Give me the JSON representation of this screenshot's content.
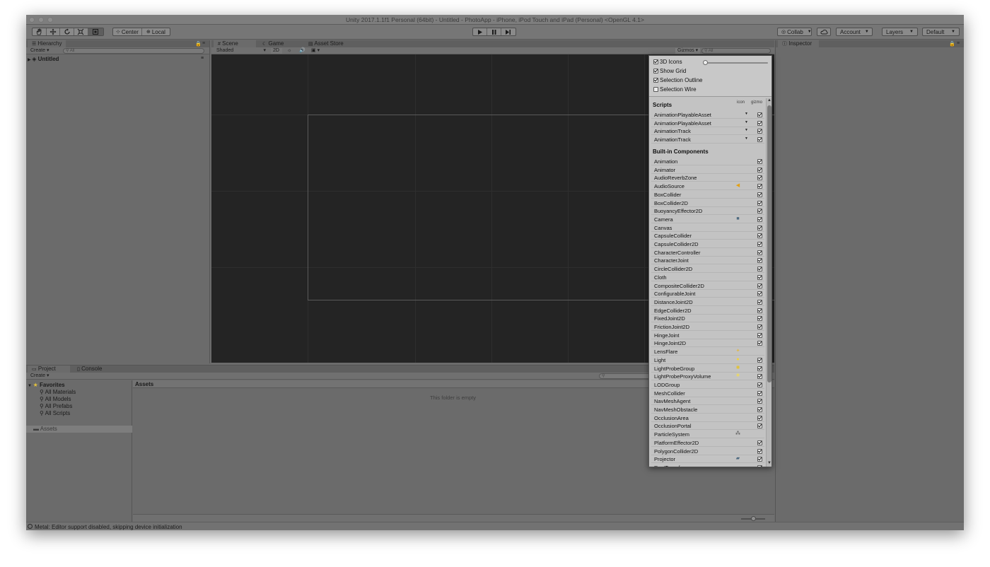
{
  "window": {
    "title": "Unity 2017.1.1f1 Personal (64bit) - Untitled - PhotoApp - iPhone, iPod Touch and iPad (Personal) <OpenGL 4.1>"
  },
  "toolbar": {
    "pivot_center": "Center",
    "pivot_local": "Local",
    "collab": "Collab",
    "account": "Account",
    "layers": "Layers",
    "layout": "Default",
    "icons": [
      "hand-icon",
      "move-icon",
      "rotate-icon",
      "scale-icon",
      "rect-tool-icon",
      "play-icon",
      "pause-icon",
      "step-icon",
      "cloud-icon"
    ]
  },
  "hierarchy": {
    "tab": "Hierarchy",
    "create": "Create",
    "search_placeholder": "All",
    "scene_item": "Untitled"
  },
  "scene": {
    "tabs": [
      "Scene",
      "Game",
      "Asset Store"
    ],
    "shading": "Shaded",
    "mode_2d": "2D",
    "gizmos": "Gizmos",
    "search_placeholder": "All"
  },
  "inspector": {
    "tab": "Inspector"
  },
  "gizmos_popup": {
    "options": [
      {
        "label": "3D Icons",
        "checked": true
      },
      {
        "label": "Show Grid",
        "checked": true
      },
      {
        "label": "Selection Outline",
        "checked": true
      },
      {
        "label": "Selection Wire",
        "checked": false
      }
    ],
    "col_icon": "icon",
    "col_gizmo": "gizmo",
    "scripts_header": "Scripts",
    "scripts": [
      "AnimationPlayableAsset",
      "AnimationPlayableAsset",
      "AnimationTrack",
      "AnimationTrack"
    ],
    "builtin_header": "Built-in Components",
    "builtin": [
      {
        "label": "Animation",
        "icon": "",
        "gizmo": true
      },
      {
        "label": "Animator",
        "icon": "",
        "gizmo": true
      },
      {
        "label": "AudioReverbZone",
        "icon": "",
        "gizmo": true
      },
      {
        "label": "AudioSource",
        "icon": "speaker-icon",
        "gizmo": true
      },
      {
        "label": "BoxCollider",
        "icon": "",
        "gizmo": true
      },
      {
        "label": "BoxCollider2D",
        "icon": "",
        "gizmo": true
      },
      {
        "label": "BuoyancyEffector2D",
        "icon": "",
        "gizmo": true
      },
      {
        "label": "Camera",
        "icon": "camera-icon",
        "gizmo": true
      },
      {
        "label": "Canvas",
        "icon": "",
        "gizmo": true
      },
      {
        "label": "CapsuleCollider",
        "icon": "",
        "gizmo": true
      },
      {
        "label": "CapsuleCollider2D",
        "icon": "",
        "gizmo": true
      },
      {
        "label": "CharacterController",
        "icon": "",
        "gizmo": true
      },
      {
        "label": "CharacterJoint",
        "icon": "",
        "gizmo": true
      },
      {
        "label": "CircleCollider2D",
        "icon": "",
        "gizmo": true
      },
      {
        "label": "Cloth",
        "icon": "",
        "gizmo": true
      },
      {
        "label": "CompositeCollider2D",
        "icon": "",
        "gizmo": true
      },
      {
        "label": "ConfigurableJoint",
        "icon": "",
        "gizmo": true
      },
      {
        "label": "DistanceJoint2D",
        "icon": "",
        "gizmo": true
      },
      {
        "label": "EdgeCollider2D",
        "icon": "",
        "gizmo": true
      },
      {
        "label": "FixedJoint2D",
        "icon": "",
        "gizmo": true
      },
      {
        "label": "FrictionJoint2D",
        "icon": "",
        "gizmo": true
      },
      {
        "label": "HingeJoint",
        "icon": "",
        "gizmo": true
      },
      {
        "label": "HingeJoint2D",
        "icon": "",
        "gizmo": true
      },
      {
        "label": "LensFlare",
        "icon": "lens-flare-icon",
        "gizmo": null
      },
      {
        "label": "Light",
        "icon": "light-bulb-icon",
        "gizmo": true
      },
      {
        "label": "LightProbeGroup",
        "icon": "light-probe-icon",
        "gizmo": true
      },
      {
        "label": "LightProbeProxyVolume",
        "icon": "light-probe-proxy-icon",
        "gizmo": true
      },
      {
        "label": "LODGroup",
        "icon": "",
        "gizmo": true
      },
      {
        "label": "MeshCollider",
        "icon": "",
        "gizmo": true
      },
      {
        "label": "NavMeshAgent",
        "icon": "",
        "gizmo": true
      },
      {
        "label": "NavMeshObstacle",
        "icon": "",
        "gizmo": true
      },
      {
        "label": "OcclusionArea",
        "icon": "",
        "gizmo": true
      },
      {
        "label": "OcclusionPortal",
        "icon": "",
        "gizmo": true
      },
      {
        "label": "ParticleSystem",
        "icon": "particle-icon",
        "gizmo": null
      },
      {
        "label": "PlatformEffector2D",
        "icon": "",
        "gizmo": true
      },
      {
        "label": "PolygonCollider2D",
        "icon": "",
        "gizmo": true
      },
      {
        "label": "Projector",
        "icon": "projector-icon",
        "gizmo": true
      },
      {
        "label": "RectTransform",
        "icon": "",
        "gizmo": true
      }
    ]
  },
  "project": {
    "tabs": [
      "Project",
      "Console"
    ],
    "create": "Create",
    "favorites": "Favorites",
    "favorite_items": [
      "All Materials",
      "All Models",
      "All Prefabs",
      "All Scripts"
    ],
    "assets_root": "Assets",
    "breadcrumb": "Assets",
    "empty_message": "This folder is empty"
  },
  "status": {
    "message": "Metal: Editor support disabled, skipping device initialization"
  },
  "colors": {
    "accent_selected": "#5b7fb4",
    "speaker": "#e3a013",
    "light": "#f2d23c"
  }
}
